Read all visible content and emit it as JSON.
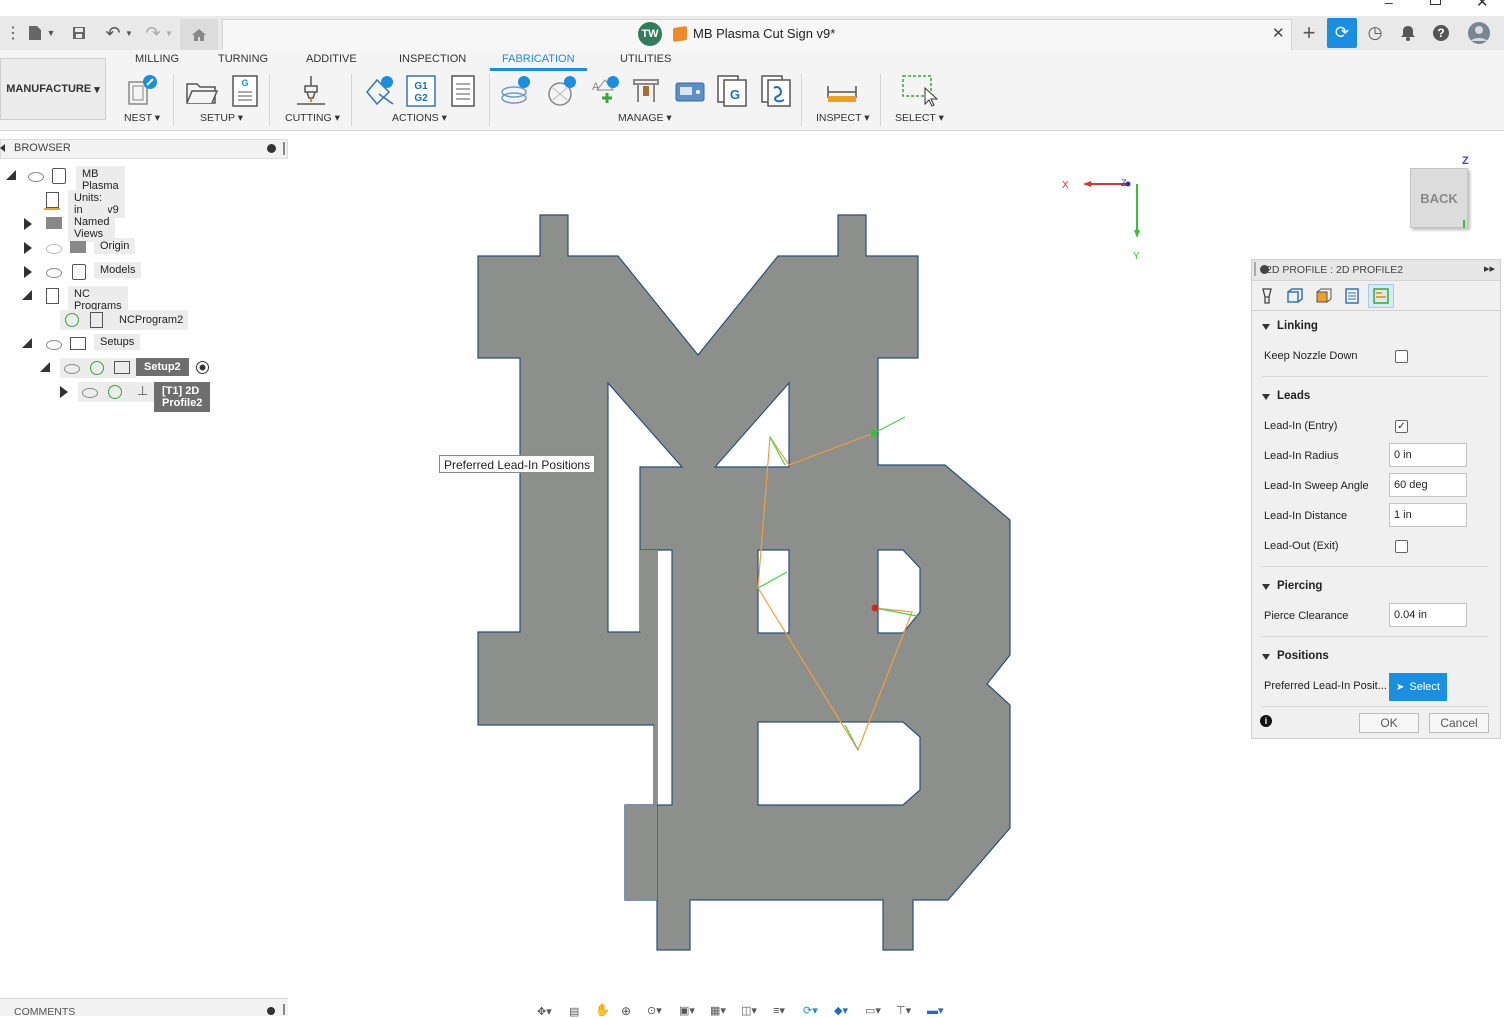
{
  "app": {
    "user_initials": "TW",
    "document_title": "MB Plasma Cut Sign v9*",
    "accent_color": "#1a8ee0"
  },
  "toolbar": {
    "workspace": "MANUFACTURE",
    "tabs": [
      "MILLING",
      "TURNING",
      "ADDITIVE",
      "INSPECTION",
      "FABRICATION",
      "UTILITIES"
    ],
    "active_tab": "FABRICATION",
    "groups": {
      "nest": "NEST",
      "setup": "SETUP",
      "cutting": "CUTTING",
      "actions": "ACTIONS",
      "manage": "MANAGE",
      "inspect": "INSPECT",
      "select": "SELECT"
    },
    "g1g2_label_top": "G1",
    "g1g2_label_bottom": "G2",
    "g_label": "G"
  },
  "browser": {
    "title": "BROWSER",
    "root": "MB Plasma Cut Sign v9",
    "units": "Units: in",
    "named_views": "Named Views",
    "origin": "Origin",
    "models": "Models",
    "nc_programs": "NC Programs",
    "nc_program": "NCProgram2",
    "setups": "Setups",
    "setup": "Setup2",
    "operation": "[T1] 2D Profile2"
  },
  "viewport": {
    "tooltip": "Preferred Lead-In Positions",
    "axis_x": "X",
    "axis_y": "Y",
    "axis_z": "Z",
    "viewcube_face": "BACK",
    "viewcube_z": "Z"
  },
  "panel": {
    "title": "2D PROFILE : 2D PROFILE2",
    "sections": {
      "linking": "Linking",
      "leads": "Leads",
      "piercing": "Piercing",
      "positions": "Positions"
    },
    "keep_nozzle_down": {
      "label": "Keep Nozzle Down",
      "checked": false
    },
    "lead_in_entry": {
      "label": "Lead-In (Entry)",
      "checked": true
    },
    "lead_in_radius": {
      "label": "Lead-In Radius",
      "value": "0 in"
    },
    "lead_in_sweep_angle": {
      "label": "Lead-In Sweep Angle",
      "value": "60 deg"
    },
    "lead_in_distance": {
      "label": "Lead-In Distance",
      "value": "1 in"
    },
    "lead_out_exit": {
      "label": "Lead-Out (Exit)",
      "checked": false
    },
    "pierce_clearance": {
      "label": "Pierce Clearance",
      "value": "0.04 in"
    },
    "preferred_positions": {
      "label": "Preferred Lead-In Posit...",
      "button": "Select"
    },
    "ok": "OK",
    "cancel": "Cancel"
  },
  "comments": {
    "title": "COMMENTS"
  }
}
